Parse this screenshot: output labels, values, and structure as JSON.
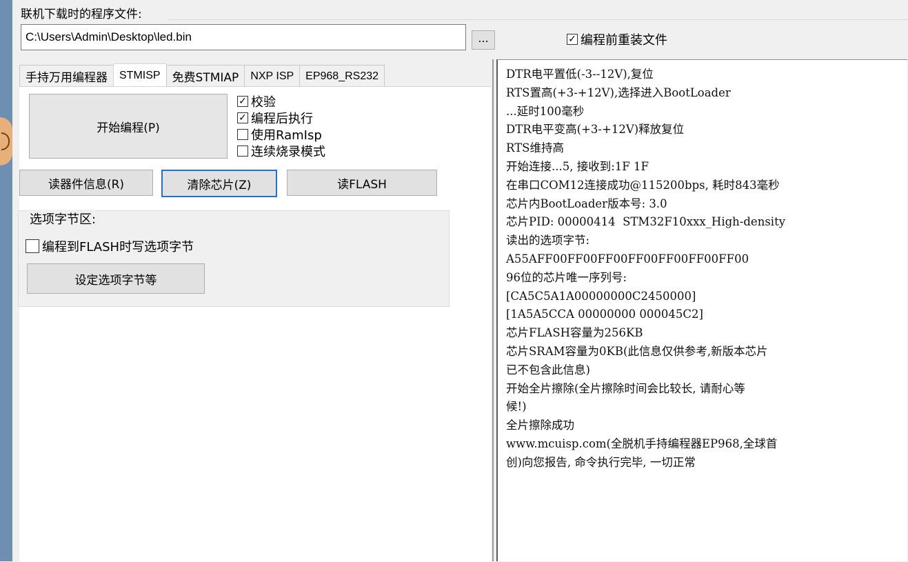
{
  "program_file": {
    "group_title": "联机下载时的程序文件:",
    "path_value": "C:\\Users\\Admin\\Desktop\\led.bin",
    "browse_label": "...",
    "reload_label": "编程前重装文件",
    "reload_checked": true
  },
  "tabs": [
    {
      "label": "手持万用编程器",
      "active": false
    },
    {
      "label": "STMISP",
      "active": true
    },
    {
      "label": "免费STMIAP",
      "active": false
    },
    {
      "label": "NXP ISP",
      "active": false
    },
    {
      "label": "EP968_RS232",
      "active": false
    }
  ],
  "stmisp": {
    "start_button": "开始编程(P)",
    "checks": [
      {
        "label": "校验",
        "checked": true
      },
      {
        "label": "编程后执行",
        "checked": true
      },
      {
        "label": "使用RamIsp",
        "checked": false
      },
      {
        "label": "连续烧录模式",
        "checked": false
      }
    ],
    "read_info_button": "读器件信息(R)",
    "erase_button": "清除芯片(Z)",
    "read_flash_button": "读FLASH",
    "option_group_title": "选项字节区:",
    "write_option_label": "编程到FLASH时写选项字节",
    "write_option_checked": false,
    "set_option_button": "设定选项字节等"
  },
  "log_lines": [
    "DTR电平置低(-3--12V),复位",
    "RTS置高(+3-+12V),选择进入BootLoader",
    "...延时100毫秒",
    "DTR电平变高(+3-+12V)释放复位",
    "RTS维持高",
    "开始连接...5, 接收到:1F 1F",
    "在串口COM12连接成功@115200bps, 耗时843毫秒",
    "芯片内BootLoader版本号: 3.0",
    "芯片PID: 00000414  STM32F10xxx_High-density",
    "读出的选项字节:",
    "A55AFF00FF00FF00FF00FF00FF00FF00",
    "96位的芯片唯一序列号:",
    "[CA5C5A1A00000000C2450000]",
    "[1A5A5CCA 00000000 000045C2]",
    "芯片FLASH容量为256KB",
    "芯片SRAM容量为0KB(此信息仅供参考,新版本芯片",
    "已不包含此信息)",
    "开始全片擦除(全片擦除时间会比较长, 请耐心等",
    "候!)",
    "全片擦除成功",
    "www.mcuisp.com(全脱机手持编程器EP968,全球首",
    "创)向您报告, 命令执行完毕, 一切正常"
  ]
}
